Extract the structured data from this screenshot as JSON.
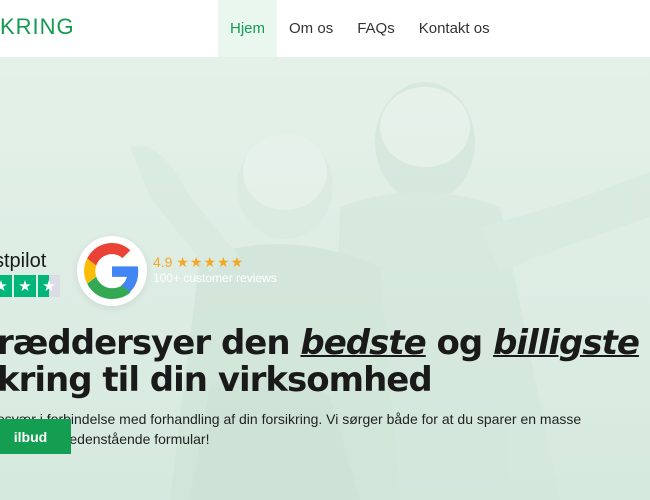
{
  "header": {
    "logo_text": "KRING",
    "nav": [
      {
        "label": "Hjem",
        "active": true
      },
      {
        "label": "Om os",
        "active": false
      },
      {
        "label": "FAQs",
        "active": false
      },
      {
        "label": "Kontakt os",
        "active": false
      }
    ]
  },
  "reviews": {
    "trustpilot": {
      "label": "stpilot",
      "icon": "trustpilot-star-icon"
    },
    "google": {
      "icon": "google-g-icon",
      "rating": "4.9",
      "stars": "★★★★★",
      "count_text": "100+ customer reviews"
    }
  },
  "hero": {
    "headline_line1_a": "ræddersyer den ",
    "headline_line1_b": "bedste",
    "headline_line1_c": " og ",
    "headline_line1_d": "billigste",
    "headline_line2": "kring til din virksomhed",
    "subtext_line1": "esvær i forbindelse med forhandling af din forsikring. Vi sørger både for at du sparer en masse",
    "subtext_line2": "e – udfyld nedenstående formular!",
    "cta_label": "ilbud"
  },
  "colors": {
    "brand": "#149a52",
    "star": "#f5a623",
    "trustpilot": "#00b67a"
  }
}
